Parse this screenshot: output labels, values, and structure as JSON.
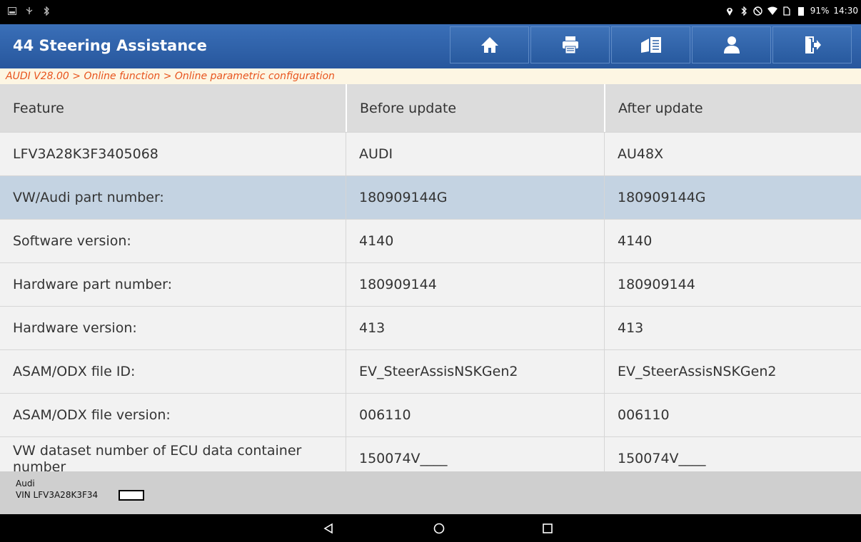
{
  "status_bar": {
    "left_icons": [
      "screenshot-icon",
      "usb-icon",
      "bluetooth-icon"
    ],
    "right_icons": [
      "location-icon",
      "bluetooth-icon",
      "dnd-icon",
      "wifi-icon",
      "sim-icon",
      "battery-icon"
    ],
    "battery": "91%",
    "time": "14:30"
  },
  "header": {
    "title": "44 Steering Assistance",
    "toolbar": [
      "home-icon",
      "print-icon",
      "report-icon",
      "user-icon",
      "exit-icon"
    ]
  },
  "breadcrumb": "AUDI V28.00 > Online function > Online parametric configuration",
  "table": {
    "columns": [
      "Feature",
      "Before update",
      "After update"
    ],
    "rows": [
      [
        "LFV3A28K3F3405068",
        "AUDI",
        "AU48X"
      ],
      [
        "VW/Audi part number:",
        "180909144G",
        "180909144G"
      ],
      [
        "Software version:",
        "4140",
        "4140"
      ],
      [
        "Hardware part number:",
        "180909144",
        "180909144"
      ],
      [
        "Hardware version:",
        "413",
        "413"
      ],
      [
        "ASAM/ODX file ID:",
        "EV_SteerAssisNSKGen2",
        "EV_SteerAssisNSKGen2"
      ],
      [
        "ASAM/ODX file version:",
        "006110",
        "006110"
      ],
      [
        "VW dataset number of ECU data container number",
        "150074V____",
        "150074V____"
      ]
    ],
    "selected_row": 1
  },
  "footer": {
    "make": "Audi",
    "vin": "VIN LFV3A28K3F34"
  },
  "colors": {
    "header_blue": "#2d60a8",
    "breadcrumb_text": "#e8541e",
    "selected_row": "#c4d3e2"
  }
}
